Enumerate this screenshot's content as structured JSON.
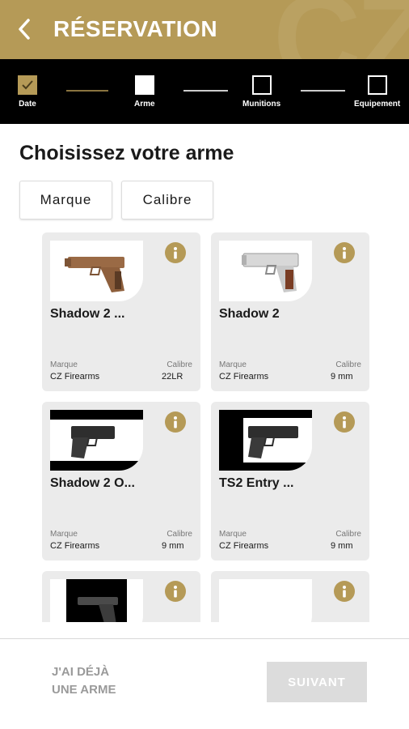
{
  "header": {
    "title": "RÉSERVATION",
    "accent_color": "#b59a57",
    "back_icon": "chevron-left-icon"
  },
  "stepper": {
    "steps": [
      {
        "label": "Date",
        "state": "done"
      },
      {
        "label": "Arme",
        "state": "active"
      },
      {
        "label": "Munitions",
        "state": "pending"
      },
      {
        "label": "Equipement",
        "state": "pending"
      }
    ]
  },
  "main": {
    "title": "Choisissez votre arme",
    "filters": [
      "Marque",
      "Calibre"
    ],
    "cards": [
      {
        "name": "Shadow 2 ...",
        "brand_label": "Marque",
        "brand": "CZ Firearms",
        "caliber_label": "Calibre",
        "caliber": "22LR",
        "image": "bronze-pistol"
      },
      {
        "name": "Shadow 2",
        "brand_label": "Marque",
        "brand": "CZ Firearms",
        "caliber_label": "Calibre",
        "caliber": "9 mm",
        "image": "silver-pistol"
      },
      {
        "name": "Shadow 2 O...",
        "brand_label": "Marque",
        "brand": "CZ Firearms",
        "caliber_label": "Calibre",
        "caliber": "9 mm",
        "image": "black-pistol"
      },
      {
        "name": "TS2 Entry ...",
        "brand_label": "Marque",
        "brand": "CZ Firearms",
        "caliber_label": "Calibre",
        "caliber": "9 mm",
        "image": "black-pistol"
      },
      {
        "name": "",
        "image": "dark-pistol"
      },
      {
        "name": "",
        "image": "empty"
      }
    ]
  },
  "footer": {
    "already_line1": "J'AI DÉJÀ",
    "already_line2": "UNE ARME",
    "next_label": "SUIVANT"
  }
}
